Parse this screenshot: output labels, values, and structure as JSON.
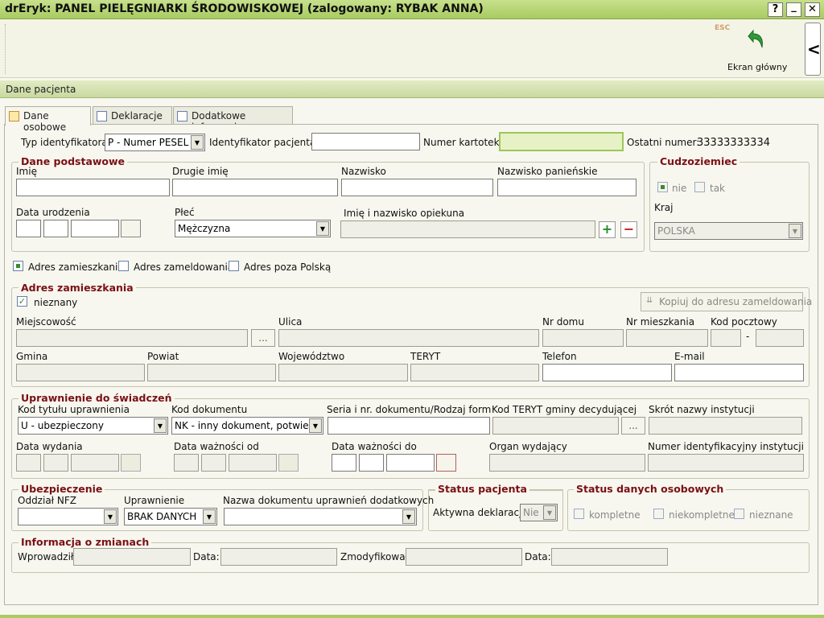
{
  "window": {
    "title": "drEryk: PANEL PIELĘGNIARKI ŚRODOWISKOWEJ (zalogowany: RYBAK ANNA)",
    "help": "?",
    "minimize": "_",
    "close": "✕"
  },
  "toolbar": {
    "esc": "ESC",
    "home_label": "Ekran główny",
    "collapse": "<"
  },
  "section_title": "Dane pacjenta",
  "tabs": [
    {
      "label": "Dane osobowe"
    },
    {
      "label": "Deklaracje"
    },
    {
      "label": "Dodatkowe informacje"
    }
  ],
  "id_row": {
    "typ_label": "Typ identyfikatora",
    "typ_value": "P - Numer PESEL",
    "identyfikator_label": "Identyfikator pacjenta",
    "identyfikator_value": "",
    "kartoteka_label": "Numer kartoteki",
    "kartoteka_value": "",
    "ostatni_label": "Ostatni numer:",
    "ostatni_value": "33333333334"
  },
  "dane_podstawowe": {
    "title": "Dane podstawowe",
    "imie": "Imię",
    "drugie_imie": "Drugie imię",
    "nazwisko": "Nazwisko",
    "nazwisko_panienskie": "Nazwisko panieńskie",
    "data_urodzenia": "Data urodzenia",
    "plec": "Płeć",
    "plec_value": "Mężczyzna",
    "opiekun": "Imię i nazwisko opiekuna"
  },
  "cudzoziemiec": {
    "title": "Cudzoziemiec",
    "nie": "nie",
    "tak": "tak",
    "kraj": "Kraj",
    "kraj_value": "POLSKA"
  },
  "adres_checks": {
    "zamieszkania": "Adres zamieszkania",
    "zameldowania": "Adres zameldowania",
    "poza": "Adres poza Polską"
  },
  "adres_zamieszkania": {
    "title": "Adres zamieszkania",
    "nieznany": "nieznany",
    "kopiuj": "Kopiuj do adresu zameldowania",
    "miejscowosc": "Miejscowość",
    "ulica": "Ulica",
    "nr_domu": "Nr domu",
    "nr_mieszkania": "Nr mieszkania",
    "kod": "Kod pocztowy",
    "dash": "-",
    "gmina": "Gmina",
    "powiat": "Powiat",
    "wojewodztwo": "Województwo",
    "teryt": "TERYT",
    "telefon": "Telefon",
    "email": "E-mail",
    "dots": "..."
  },
  "uprawnienie": {
    "title": "Uprawnienie do świadczeń",
    "kod_tytulu": "Kod tytułu uprawnienia",
    "kod_tytulu_value": "U - ubezpieczony",
    "kod_dokumentu": "Kod dokumentu",
    "kod_dokumentu_value": "NK - inny dokument, potwierd",
    "seria": "Seria i nr. dokumentu/Rodzaj form. E",
    "kod_teryt": "Kod TERYT gminy decydującej",
    "skrot": "Skrót nazwy instytucji",
    "data_wydania": "Data wydania",
    "waznosci_od": "Data ważności od",
    "waznosci_do": "Data ważności do",
    "organ": "Organ wydający",
    "numer_inst": "Numer identyfikacyjny instytucji",
    "dots": "..."
  },
  "ubezpieczenie": {
    "title": "Ubezpieczenie",
    "oddzial": "Oddział NFZ",
    "uprawnienie": "Uprawnienie",
    "uprawnienie_value": "BRAK DANYCH",
    "nazwa_dok": "Nazwa dokumentu uprawnień dodatkowych"
  },
  "status_pacjenta": {
    "title": "Status pacjenta",
    "aktywna": "Aktywna deklaracja",
    "aktywna_value": "Nie"
  },
  "status_danych": {
    "title": "Status danych osobowych",
    "kompletne": "kompletne",
    "niekompletne": "niekompletne",
    "nieznane": "nieznane"
  },
  "informacja": {
    "title": "Informacja o zmianach",
    "wprowadzil": "Wprowadził:",
    "data1": "Data:",
    "zmodyfikowal": "Zmodyfikował:",
    "data2": "Data:"
  }
}
